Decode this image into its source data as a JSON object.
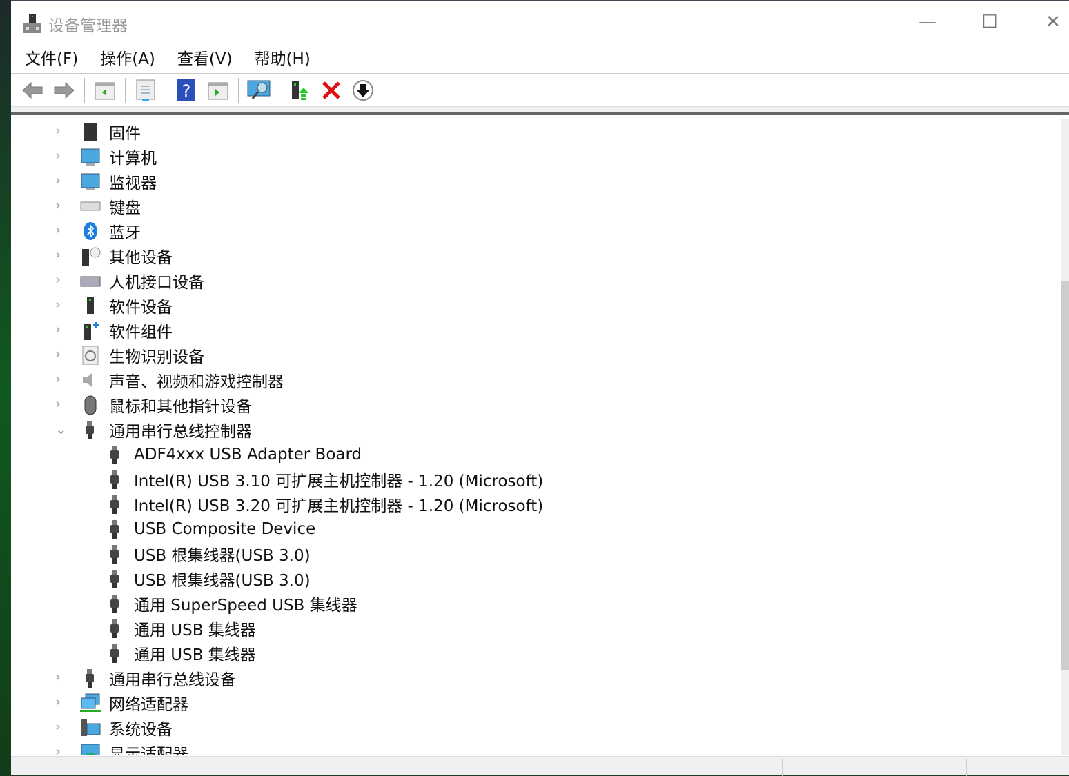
{
  "window": {
    "title": "设备管理器",
    "minimize": "—",
    "maximize": "☐",
    "close": "✕"
  },
  "menu": [
    "文件(F)",
    "操作(A)",
    "查看(V)",
    "帮助(H)"
  ],
  "toolbar": [
    "back",
    "forward",
    "show-hide-console-tree",
    "properties",
    "help",
    "show-hide-action-pane",
    "scan-hardware",
    "update-driver",
    "uninstall",
    "disable"
  ],
  "tree": {
    "before": [
      {
        "label": "固件",
        "icon": "firmware-icon"
      },
      {
        "label": "计算机",
        "icon": "computer-icon"
      },
      {
        "label": "监视器",
        "icon": "monitor-icon"
      },
      {
        "label": "键盘",
        "icon": "keyboard-icon"
      },
      {
        "label": "蓝牙",
        "icon": "bluetooth-icon"
      },
      {
        "label": "其他设备",
        "icon": "other-devices-icon"
      },
      {
        "label": "人机接口设备",
        "icon": "hid-icon"
      },
      {
        "label": "软件设备",
        "icon": "software-device-icon"
      },
      {
        "label": "软件组件",
        "icon": "software-component-icon"
      },
      {
        "label": "生物识别设备",
        "icon": "biometric-icon"
      },
      {
        "label": "声音、视频和游戏控制器",
        "icon": "speaker-icon"
      },
      {
        "label": "鼠标和其他指针设备",
        "icon": "mouse-icon"
      }
    ],
    "expanded": {
      "label": "通用串行总线控制器",
      "icon": "usb-icon",
      "children": [
        "ADF4xxx USB Adapter Board",
        "Intel(R) USB 3.10 可扩展主机控制器 - 1.20 (Microsoft)",
        "Intel(R) USB 3.20 可扩展主机控制器 - 1.20 (Microsoft)",
        "USB Composite Device",
        "USB 根集线器(USB 3.0)",
        "USB 根集线器(USB 3.0)",
        "通用 SuperSpeed USB 集线器",
        "通用 USB 集线器",
        "通用 USB 集线器"
      ]
    },
    "after": [
      {
        "label": "通用串行总线设备",
        "icon": "usb-icon"
      },
      {
        "label": "网络适配器",
        "icon": "network-icon"
      },
      {
        "label": "系统设备",
        "icon": "system-icon"
      },
      {
        "label": "显示适配器",
        "icon": "display-adapter-icon"
      }
    ]
  }
}
